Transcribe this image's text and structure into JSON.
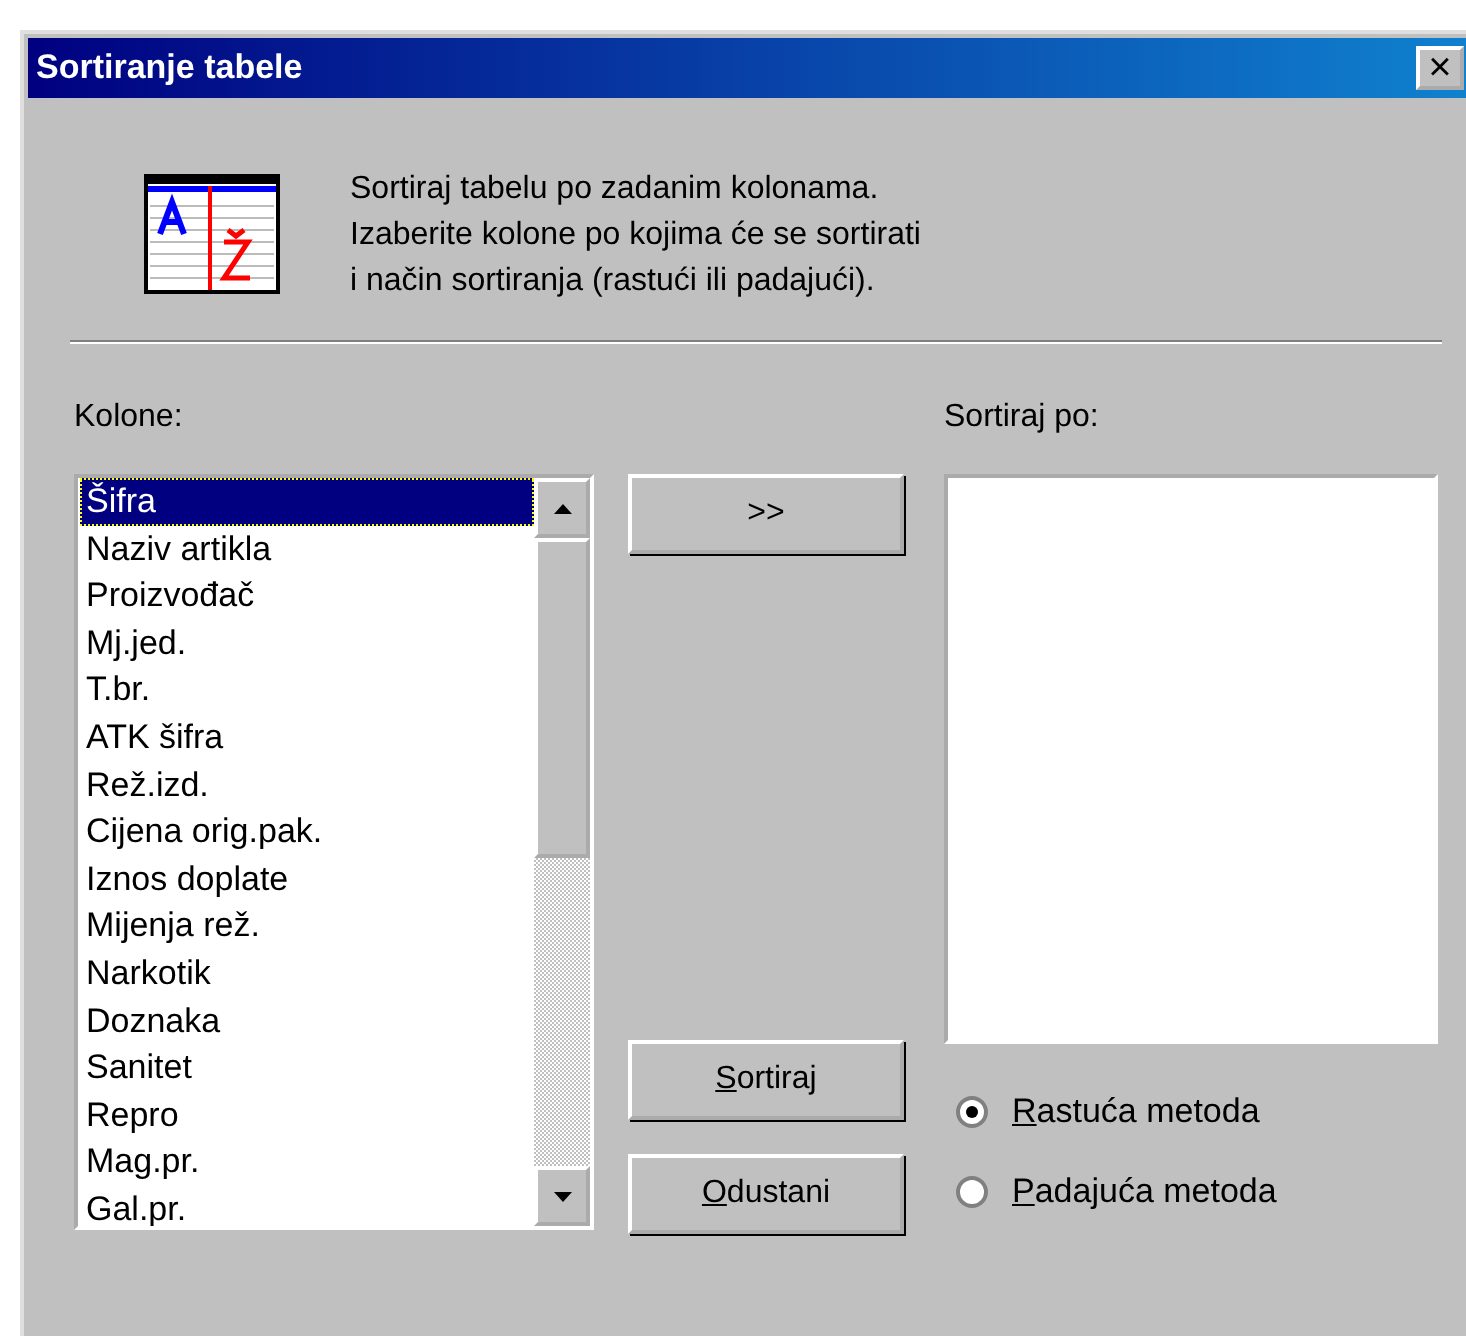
{
  "window": {
    "title": "Sortiranje tabele",
    "close": "×"
  },
  "intro": [
    "Sortiraj tabelu po zadanim kolonama.",
    "Izaberite kolone po kojima će se sortirati",
    "i način sortiranja (rastući ili padajući)."
  ],
  "columns": {
    "label": "Kolone:",
    "items": [
      {
        "text": "Šifra",
        "selected": true
      },
      {
        "text": "Naziv artikla",
        "selected": false
      },
      {
        "text": "Proizvođač",
        "selected": false
      },
      {
        "text": "Mj.jed.",
        "selected": false
      },
      {
        "text": "T.br.",
        "selected": false
      },
      {
        "text": "ATK šifra",
        "selected": false
      },
      {
        "text": "Rež.izd.",
        "selected": false
      },
      {
        "text": "Cijena orig.pak.",
        "selected": false
      },
      {
        "text": "Iznos doplate",
        "selected": false
      },
      {
        "text": "Mijenja rež.",
        "selected": false
      },
      {
        "text": "Narkotik",
        "selected": false
      },
      {
        "text": "Doznaka",
        "selected": false
      },
      {
        "text": "Sanitet",
        "selected": false
      },
      {
        "text": "Repro",
        "selected": false
      },
      {
        "text": "Mag.pr.",
        "selected": false
      },
      {
        "text": "Gal.pr.",
        "selected": false
      }
    ]
  },
  "add_button": ">>",
  "sort_by": {
    "label": "Sortiraj po:"
  },
  "buttons": [
    {
      "access_key": "S",
      "rest": "ortiraj"
    },
    {
      "access_key": "O",
      "rest": "dustani"
    }
  ],
  "order": [
    {
      "access_key": "R",
      "rest": "astuća metoda",
      "selected": true
    },
    {
      "access_key": "P",
      "rest": "adajuća metoda",
      "selected": false
    }
  ]
}
